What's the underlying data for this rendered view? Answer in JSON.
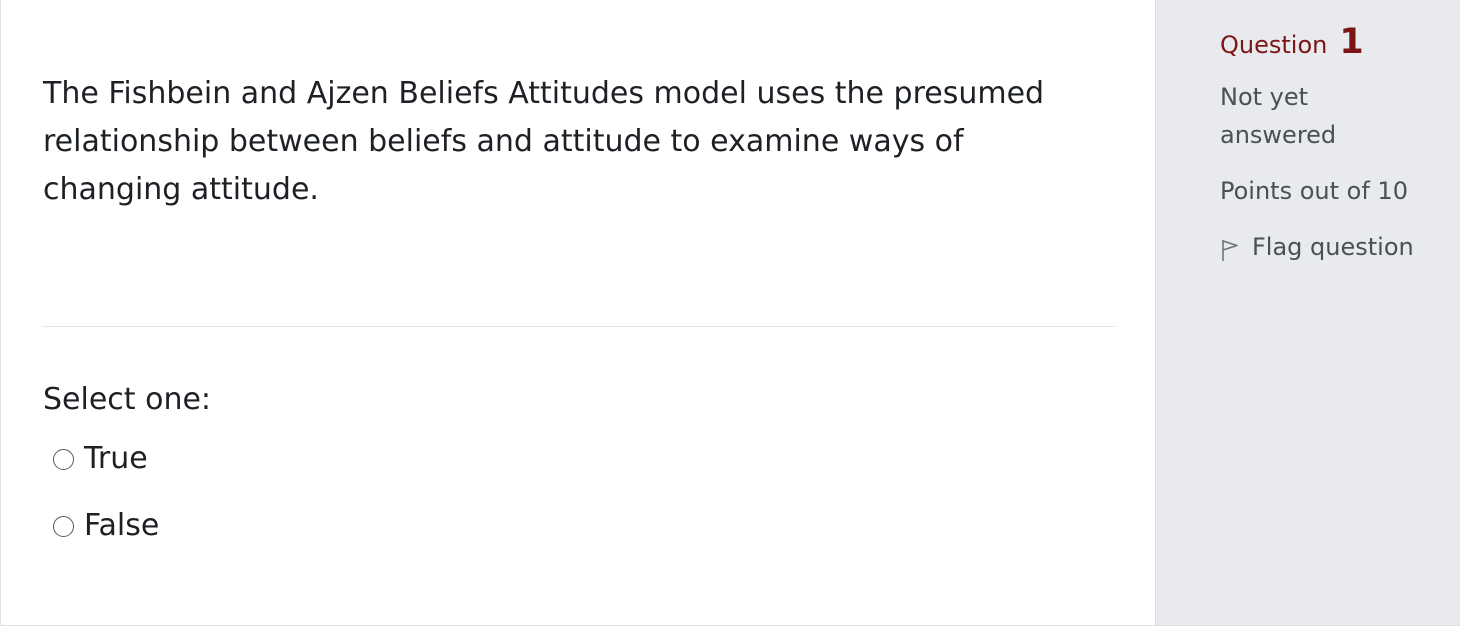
{
  "question": {
    "text": "The Fishbein and Ajzen Beliefs Attitudes model uses the presumed relationship between beliefs and attitude to examine ways of changing attitude.",
    "prompt": "Select one:",
    "options": [
      {
        "label": "True",
        "selected": false
      },
      {
        "label": "False",
        "selected": false
      }
    ]
  },
  "info": {
    "question_word": "Question",
    "question_number": "1",
    "status": "Not yet answered",
    "points": "Points out of 10",
    "flag_label": "Flag question",
    "flag_icon": "flag-outline-icon",
    "accent_color": "#7a1616"
  }
}
